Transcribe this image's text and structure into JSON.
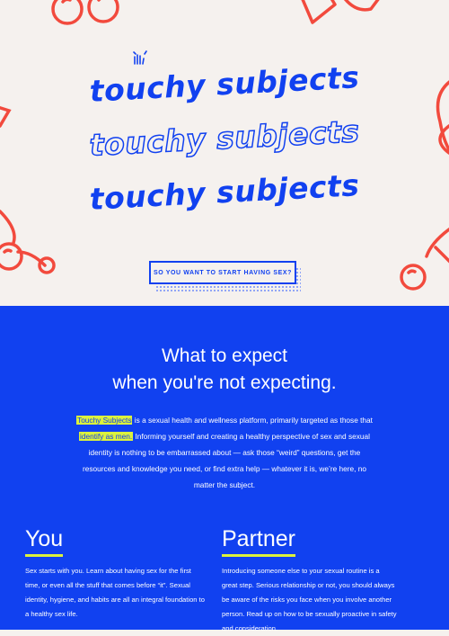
{
  "hero": {
    "title_lines": [
      "touchy subjects",
      "touchy subjects",
      "touchy subjects"
    ],
    "cta_label": "SO YOU WANT TO START HAVING SEX?"
  },
  "intro": {
    "heading_line1": "What to expect",
    "heading_line2": "when you're not expecting.",
    "brand_highlight": "Touchy Subjects",
    "text_1": " is a sexual health and wellness platform, primarily targeted as those that ",
    "identity_highlight": "identify as men.",
    "text_2": " Informing yourself and creating a healthy perspective of sex and sexual identity is nothing to be embarrassed about — ask those “weird” questions, get the resources and knowledge you need, or find extra help — whatever it is, we’re here, no matter the subject."
  },
  "sections": [
    {
      "title": "You",
      "body": "Sex starts with you. Learn about having sex for the first time, or even all the stuff that comes before “it”. Sexual identity, hygiene, and habits are all an integral foundation to a healthy sex life."
    },
    {
      "title": "Partner",
      "body": "Introducing someone else to your sexual routine is a great step. Serious relationship or not, you should always be aware of the risks you face when you involve another person. Read up on how to be sexually proactive in safety and consideration."
    }
  ],
  "colors": {
    "brand_blue": "#1141f0",
    "doodle_red": "#f24a3d",
    "highlight": "#dcf23c",
    "cream": "#f5f1ee"
  },
  "icons": [
    "cherry-doodle",
    "heart-doodle",
    "wave-hand-icon"
  ]
}
